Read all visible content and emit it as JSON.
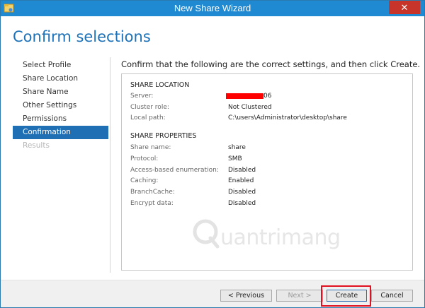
{
  "window": {
    "title": "New Share Wizard",
    "close_glyph": "✕"
  },
  "page": {
    "title": "Confirm selections",
    "instruction": "Confirm that the following are the correct settings, and then click Create."
  },
  "nav": {
    "items": [
      {
        "label": "Select Profile"
      },
      {
        "label": "Share Location"
      },
      {
        "label": "Share Name"
      },
      {
        "label": "Other Settings"
      },
      {
        "label": "Permissions"
      },
      {
        "label": "Confirmation"
      },
      {
        "label": "Results"
      }
    ]
  },
  "share_location": {
    "heading": "SHARE LOCATION",
    "server_label": "Server:",
    "server_value_suffix": "06",
    "cluster_label": "Cluster role:",
    "cluster_value": "Not Clustered",
    "path_label": "Local path:",
    "path_value": "C:\\users\\Administrator\\desktop\\share"
  },
  "share_properties": {
    "heading": "SHARE PROPERTIES",
    "rows": [
      {
        "label": "Share name:",
        "value": "share"
      },
      {
        "label": "Protocol:",
        "value": "SMB"
      },
      {
        "label": "Access-based enumeration:",
        "value": "Disabled"
      },
      {
        "label": "Caching:",
        "value": "Enabled"
      },
      {
        "label": "BranchCache:",
        "value": "Disabled"
      },
      {
        "label": "Encrypt data:",
        "value": "Disabled"
      }
    ]
  },
  "watermark": {
    "text": "uantrimang"
  },
  "footer": {
    "previous": "< Previous",
    "next": "Next >",
    "create": "Create",
    "cancel": "Cancel"
  },
  "colors": {
    "titlebar": "#1f8ad1",
    "accent": "#1f6fb5",
    "page_title": "#1e72b8",
    "highlight": "#e01020",
    "redaction": "#ff0000"
  }
}
